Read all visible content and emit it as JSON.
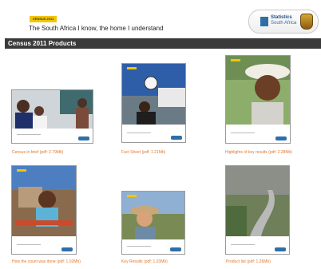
{
  "header": {
    "census_tag": "CENSUS 2011",
    "tagline": "The South Africa I know, the home I understand",
    "logo_line1": "Statistics",
    "logo_line2": "South Africa"
  },
  "section": {
    "title": "Census 2011 Products"
  },
  "products": [
    {
      "label": "Census in brief (pdf: 2.79Mb)"
    },
    {
      "label": "Fact Sheet (pdf: 1.21Mb)"
    },
    {
      "label": "Highlights of key results (pdf: 2.28Mb)"
    },
    {
      "label": "How the count was done (pdf: 1.02Mb)"
    },
    {
      "label": "Key Results (pdf: 1.03Mb)"
    },
    {
      "label": "Product list (pdf: 1.26Mb)"
    }
  ],
  "colors": {
    "accent": "#e1782d",
    "titlebar": "#3a3a3a",
    "tag": "#f2c500"
  }
}
